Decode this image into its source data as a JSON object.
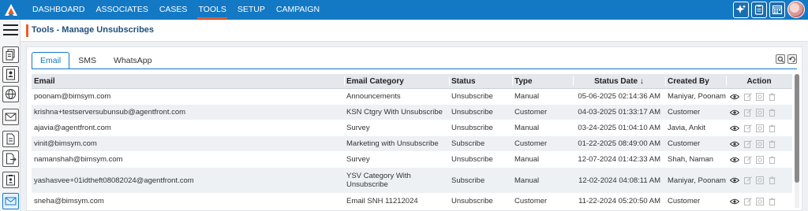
{
  "nav": {
    "items": [
      {
        "label": "DASHBOARD"
      },
      {
        "label": "ASSOCIATES"
      },
      {
        "label": "CASES"
      },
      {
        "label": "TOOLS"
      },
      {
        "label": "SETUP"
      },
      {
        "label": "CAMPAIGN"
      }
    ],
    "active": "TOOLS"
  },
  "header": {
    "title": "Tools - Manage Unsubscribes"
  },
  "tabs": [
    {
      "label": "Email"
    },
    {
      "label": "SMS"
    },
    {
      "label": "WhatsApp"
    }
  ],
  "table": {
    "columns": [
      "Email",
      "Email Category",
      "Status",
      "Type",
      "Status Date ↓",
      "Created By",
      "Action"
    ],
    "rows": [
      {
        "email": "poonam@bimsym.com",
        "category": "Announcements",
        "status": "Unsubscribe",
        "type": "Manual",
        "date": "05-06-2025 02:14:36 AM",
        "created_by": "Maniyar, Poonam"
      },
      {
        "email": "krishna+testserversubunsub@agentfront.com",
        "category": "KSN Ctgry With Unsubscribe",
        "status": "Unsubscribe",
        "type": "Customer",
        "date": "04-03-2025 01:33:17 AM",
        "created_by": "Customer"
      },
      {
        "email": "ajavia@agentfront.com",
        "category": "Survey",
        "status": "Unsubscribe",
        "type": "Manual",
        "date": "03-24-2025 01:04:10 AM",
        "created_by": "Javia, Ankit"
      },
      {
        "email": "vinit@bimsym.com",
        "category": "Marketing with Unsubscribe",
        "status": "Subscribe",
        "type": "Customer",
        "date": "01-22-2025 08:49:00 AM",
        "created_by": "Customer"
      },
      {
        "email": "namanshah@bimsym.com",
        "category": "Survey",
        "status": "Unsubscribe",
        "type": "Manual",
        "date": "12-07-2024 01:42:33 AM",
        "created_by": "Shah, Naman"
      },
      {
        "email": "yashasvee+01idtheft08082024@agentfront.com",
        "category": "YSV Category With Unsubscribe",
        "status": "Subscribe",
        "type": "Manual",
        "date": "12-02-2024 04:08:11 AM",
        "created_by": "Maniyar, Poonam"
      },
      {
        "email": "sneha@bimsym.com",
        "category": "Email SNH 11212024",
        "status": "Unsubscribe",
        "type": "Customer",
        "date": "11-22-2024 05:20:50 AM",
        "created_by": "Customer"
      }
    ]
  },
  "colors": {
    "topbar": "#1479c4",
    "accent": "#f05a28",
    "title": "#1f4f7c"
  },
  "icons": {
    "top": [
      "sparkle-icon",
      "clipboard-icon",
      "calendar-grid-icon"
    ],
    "sidebar": [
      "documents-icon",
      "contact-card-icon",
      "globe-icon",
      "email-icon",
      "document-edit-icon",
      "document-export-icon",
      "clipboard-user-icon",
      "email-active-icon"
    ],
    "row_actions": [
      "view-icon",
      "edit-icon",
      "settings-icon",
      "delete-icon"
    ]
  }
}
